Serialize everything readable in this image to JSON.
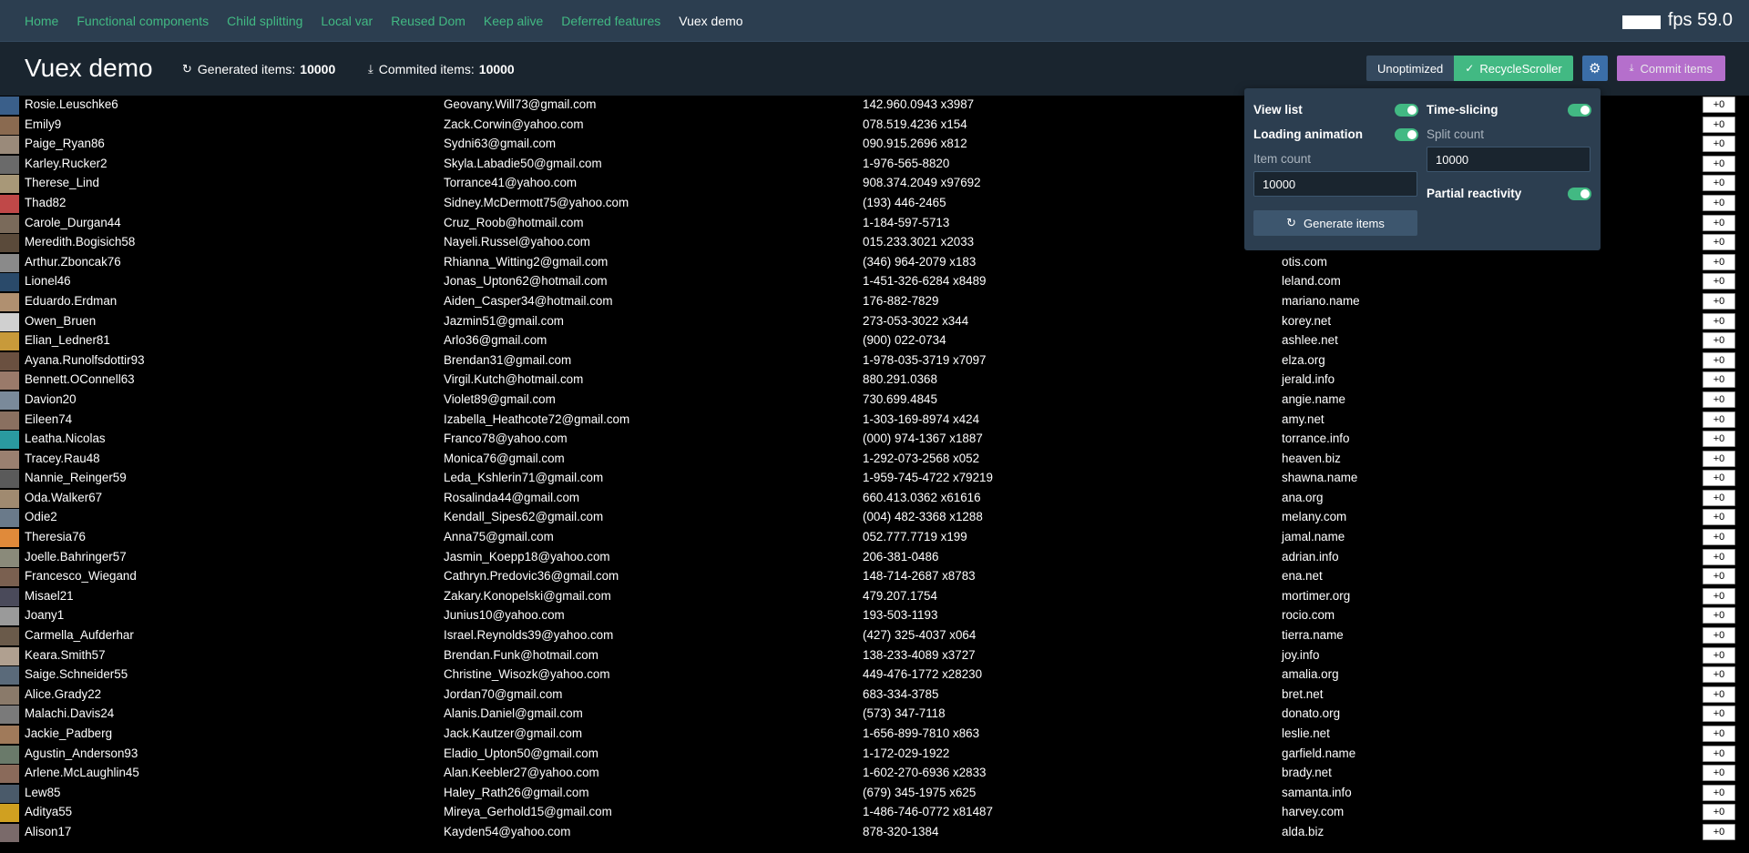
{
  "nav": {
    "links": [
      "Home",
      "Functional components",
      "Child splitting",
      "Local var",
      "Reused Dom",
      "Keep alive",
      "Deferred features",
      "Vuex demo"
    ],
    "active_index": 7,
    "fps_label": "fps 59.0"
  },
  "header": {
    "title": "Vuex demo",
    "generated_label": "Generated items:",
    "generated_value": "10000",
    "committed_label": "Commited items:",
    "committed_value": "10000"
  },
  "toolbar": {
    "unoptimized_label": "Unoptimized",
    "recycle_label": "RecycleScroller",
    "commit_label": "Commit items",
    "icons": {
      "refresh": "refresh-icon",
      "download": "download-icon",
      "check": "check-icon",
      "gear": "gear-icon"
    }
  },
  "settings": {
    "view_list_label": "View list",
    "view_list_on": true,
    "time_slicing_label": "Time-slicing",
    "time_slicing_on": true,
    "loading_animation_label": "Loading animation",
    "loading_animation_on": true,
    "split_count_label": "Split count",
    "split_count_value": "10000",
    "item_count_label": "Item count",
    "item_count_value": "10000",
    "partial_reactivity_label": "Partial reactivity",
    "partial_reactivity_on": true,
    "generate_label": "Generate items"
  },
  "colors": {
    "accent": "#42b983",
    "nav_bg": "#2c3e50",
    "commit": "#c678dd",
    "gear": "#3b6ea8"
  },
  "plus_label": "+0",
  "rows": [
    {
      "name": "Rosie.Leuschke6",
      "email": "Geovany.Will73@gmail.com",
      "phone": "142.960.0943 x3987",
      "site": "",
      "avatar": "#3a5f8a"
    },
    {
      "name": "Emily9",
      "email": "Zack.Corwin@yahoo.com",
      "phone": "078.519.4236 x154",
      "site": "",
      "avatar": "#8a6a50"
    },
    {
      "name": "Paige_Ryan86",
      "email": "Sydni63@gmail.com",
      "phone": "090.915.2696 x812",
      "site": "",
      "avatar": "#9a8a7a"
    },
    {
      "name": "Karley.Rucker2",
      "email": "Skyla.Labadie50@gmail.com",
      "phone": "1-976-565-8820",
      "site": "",
      "avatar": "#6a6a6a"
    },
    {
      "name": "Therese_Lind",
      "email": "Torrance41@yahoo.com",
      "phone": "908.374.2049 x97692",
      "site": "",
      "avatar": "#a89878"
    },
    {
      "name": "Thad82",
      "email": "Sidney.McDermott75@yahoo.com",
      "phone": "(193) 446-2465",
      "site": "",
      "avatar": "#c04848"
    },
    {
      "name": "Carole_Durgan44",
      "email": "Cruz_Roob@hotmail.com",
      "phone": "1-184-597-5713",
      "site": "",
      "avatar": "#7a6a5a"
    },
    {
      "name": "Meredith.Bogisich58",
      "email": "Nayeli.Russel@yahoo.com",
      "phone": "015.233.3021 x2033",
      "site": "",
      "avatar": "#5a4a3a"
    },
    {
      "name": "Arthur.Zboncak76",
      "email": "Rhianna_Witting2@gmail.com",
      "phone": "(346) 964-2079 x183",
      "site": "otis.com",
      "avatar": "#8a8a8a"
    },
    {
      "name": "Lionel46",
      "email": "Jonas_Upton62@hotmail.com",
      "phone": "1-451-326-6284 x8489",
      "site": "leland.com",
      "avatar": "#2a4a6a"
    },
    {
      "name": "Eduardo.Erdman",
      "email": "Aiden_Casper34@hotmail.com",
      "phone": "176-882-7829",
      "site": "mariano.name",
      "avatar": "#b09070"
    },
    {
      "name": "Owen_Bruen",
      "email": "Jazmin51@gmail.com",
      "phone": "273-053-3022 x344",
      "site": "korey.net",
      "avatar": "#d0d0d0"
    },
    {
      "name": "Elian_Ledner81",
      "email": "Arlo36@gmail.com",
      "phone": "(900) 022-0734",
      "site": "ashlee.net",
      "avatar": "#c89a3a"
    },
    {
      "name": "Ayana.Runolfsdottir93",
      "email": "Brendan31@gmail.com",
      "phone": "1-978-035-3719 x7097",
      "site": "elza.org",
      "avatar": "#6a5040"
    },
    {
      "name": "Bennett.OConnell63",
      "email": "Virgil.Kutch@hotmail.com",
      "phone": "880.291.0368",
      "site": "jerald.info",
      "avatar": "#9a7a6a"
    },
    {
      "name": "Davion20",
      "email": "Violet89@gmail.com",
      "phone": "730.699.4845",
      "site": "angie.name",
      "avatar": "#7a8a9a"
    },
    {
      "name": "Eileen74",
      "email": "Izabella_Heathcote72@gmail.com",
      "phone": "1-303-169-8974 x424",
      "site": "amy.net",
      "avatar": "#8a7060"
    },
    {
      "name": "Leatha.Nicolas",
      "email": "Franco78@yahoo.com",
      "phone": "(000) 974-1367 x1887",
      "site": "torrance.info",
      "avatar": "#2a9aa0"
    },
    {
      "name": "Tracey.Rau48",
      "email": "Monica76@gmail.com",
      "phone": "1-292-073-2568 x052",
      "site": "heaven.biz",
      "avatar": "#9a8070"
    },
    {
      "name": "Nannie_Reinger59",
      "email": "Leda_Kshlerin71@gmail.com",
      "phone": "1-959-745-4722 x79219",
      "site": "shawna.name",
      "avatar": "#5a5a5a"
    },
    {
      "name": "Oda.Walker67",
      "email": "Rosalinda44@gmail.com",
      "phone": "660.413.0362 x61616",
      "site": "ana.org",
      "avatar": "#a08a70"
    },
    {
      "name": "Odie2",
      "email": "Kendall_Sipes62@gmail.com",
      "phone": "(004) 482-3368 x1288",
      "site": "melany.com",
      "avatar": "#6a7a8a"
    },
    {
      "name": "Theresia76",
      "email": "Anna75@gmail.com",
      "phone": "052.777.7719 x199",
      "site": "jamal.name",
      "avatar": "#e08a3a"
    },
    {
      "name": "Joelle.Bahringer57",
      "email": "Jasmin_Koepp18@yahoo.com",
      "phone": "206-381-0486",
      "site": "adrian.info",
      "avatar": "#8a8a7a"
    },
    {
      "name": "Francesco_Wiegand",
      "email": "Cathryn.Predovic36@gmail.com",
      "phone": "148-714-2687 x8783",
      "site": "ena.net",
      "avatar": "#7a6050"
    },
    {
      "name": "Misael21",
      "email": "Zakary.Konopelski@gmail.com",
      "phone": "479.207.1754",
      "site": "mortimer.org",
      "avatar": "#4a4a5a"
    },
    {
      "name": "Joany1",
      "email": "Junius10@yahoo.com",
      "phone": "193-503-1193",
      "site": "rocio.com",
      "avatar": "#9a9a9a"
    },
    {
      "name": "Carmella_Aufderhar",
      "email": "Israel.Reynolds39@yahoo.com",
      "phone": "(427) 325-4037 x064",
      "site": "tierra.name",
      "avatar": "#6a5a4a"
    },
    {
      "name": "Keara.Smith57",
      "email": "Brendan.Funk@hotmail.com",
      "phone": "138-233-4089 x3727",
      "site": "joy.info",
      "avatar": "#b0a090"
    },
    {
      "name": "Saige.Schneider55",
      "email": "Christine_Wisozk@yahoo.com",
      "phone": "449-476-1772 x28230",
      "site": "amalia.org",
      "avatar": "#5a6a7a"
    },
    {
      "name": "Alice.Grady22",
      "email": "Jordan70@gmail.com",
      "phone": "683-334-3785",
      "site": "bret.net",
      "avatar": "#8a7a6a"
    },
    {
      "name": "Malachi.Davis24",
      "email": "Alanis.Daniel@gmail.com",
      "phone": "(573) 347-7118",
      "site": "donato.org",
      "avatar": "#7a7a7a"
    },
    {
      "name": "Jackie_Padberg",
      "email": "Jack.Kautzer@gmail.com",
      "phone": "1-656-899-7810 x863",
      "site": "leslie.net",
      "avatar": "#a07a5a"
    },
    {
      "name": "Agustin_Anderson93",
      "email": "Eladio_Upton50@gmail.com",
      "phone": "1-172-029-1922",
      "site": "garfield.name",
      "avatar": "#6a7a6a"
    },
    {
      "name": "Arlene.McLaughlin45",
      "email": "Alan.Keebler27@yahoo.com",
      "phone": "1-602-270-6936 x2833",
      "site": "brady.net",
      "avatar": "#8a6a5a"
    },
    {
      "name": "Lew85",
      "email": "Haley_Rath26@gmail.com",
      "phone": "(679) 345-1975 x625",
      "site": "samanta.info",
      "avatar": "#4a5a6a"
    },
    {
      "name": "Aditya55",
      "email": "Mireya_Gerhold15@gmail.com",
      "phone": "1-486-746-0772 x81487",
      "site": "harvey.com",
      "avatar": "#d0a020"
    },
    {
      "name": "Alison17",
      "email": "Kayden54@yahoo.com",
      "phone": "878-320-1384",
      "site": "alda.biz",
      "avatar": "#7a6a6a"
    }
  ]
}
